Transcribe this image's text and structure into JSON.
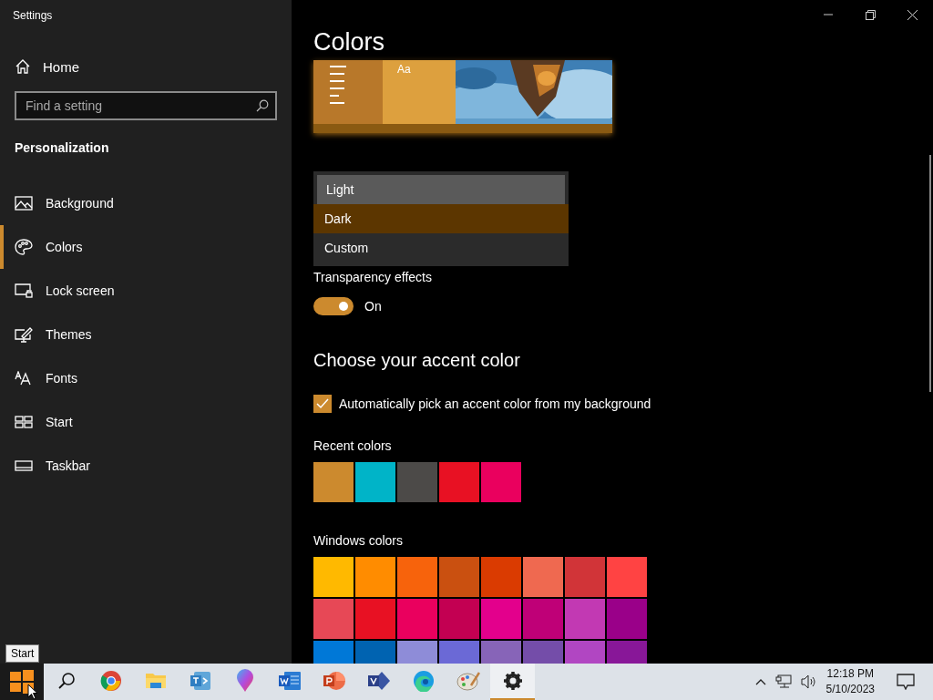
{
  "window": {
    "title": "Settings"
  },
  "sidebar": {
    "home": "Home",
    "search": {
      "placeholder": "Find a setting"
    },
    "section": "Personalization",
    "items": [
      {
        "label": "Background",
        "selected": false
      },
      {
        "label": "Colors",
        "selected": true
      },
      {
        "label": "Lock screen",
        "selected": false
      },
      {
        "label": "Themes",
        "selected": false
      },
      {
        "label": "Fonts",
        "selected": false
      },
      {
        "label": "Start",
        "selected": false
      },
      {
        "label": "Taskbar",
        "selected": false
      }
    ]
  },
  "page": {
    "title": "Colors",
    "preview": {
      "tile_text": "Aa"
    },
    "mode_menu": [
      {
        "label": "Light",
        "selected": false,
        "hovered": true
      },
      {
        "label": "Dark",
        "selected": true,
        "hovered": false
      },
      {
        "label": "Custom",
        "selected": false,
        "hovered": false
      }
    ],
    "transparency": {
      "label": "Transparency effects",
      "on": true,
      "state_text": "On"
    },
    "accent_heading": "Choose your accent color",
    "auto_pick": {
      "label": "Automatically pick an accent color from my background",
      "checked": true
    },
    "recent_label": "Recent colors",
    "recent_colors": [
      {
        "color": "#cc8a2e"
      },
      {
        "color": "#00b4c8"
      },
      {
        "color": "#4c4a48"
      },
      {
        "color": "#e81123"
      },
      {
        "color": "#ea005e"
      }
    ],
    "windows_label": "Windows colors",
    "windows_colors": [
      [
        {
          "color": "#ffb900"
        },
        {
          "color": "#ff8c00"
        },
        {
          "color": "#f7630c"
        },
        {
          "color": "#ca5010"
        },
        {
          "color": "#da3b01"
        },
        {
          "color": "#ef6950"
        },
        {
          "color": "#d13438"
        },
        {
          "color": "#ff4343"
        }
      ],
      [
        {
          "color": "#e74856"
        },
        {
          "color": "#e81123"
        },
        {
          "color": "#ea005e"
        },
        {
          "color": "#c30052"
        },
        {
          "color": "#e3008c"
        },
        {
          "color": "#bf0077"
        },
        {
          "color": "#c239b3"
        },
        {
          "color": "#9a0089"
        }
      ],
      [
        {
          "color": "#0078d7"
        },
        {
          "color": "#0063b1"
        },
        {
          "color": "#8e8cd8"
        },
        {
          "color": "#6b69d6"
        },
        {
          "color": "#8764b8"
        },
        {
          "color": "#744da9"
        },
        {
          "color": "#b146c2"
        },
        {
          "color": "#881798"
        }
      ]
    ]
  },
  "tooltip": "Start",
  "taskbar": {
    "apps": [
      {
        "selected": false
      },
      {
        "selected": false
      },
      {
        "selected": false
      },
      {
        "selected": false
      },
      {
        "selected": false
      },
      {
        "selected": false
      },
      {
        "selected": false
      },
      {
        "selected": false
      },
      {
        "selected": false
      },
      {
        "selected": false
      },
      {
        "selected": true
      }
    ],
    "time": "12:18 PM",
    "date": "5/10/2023"
  }
}
